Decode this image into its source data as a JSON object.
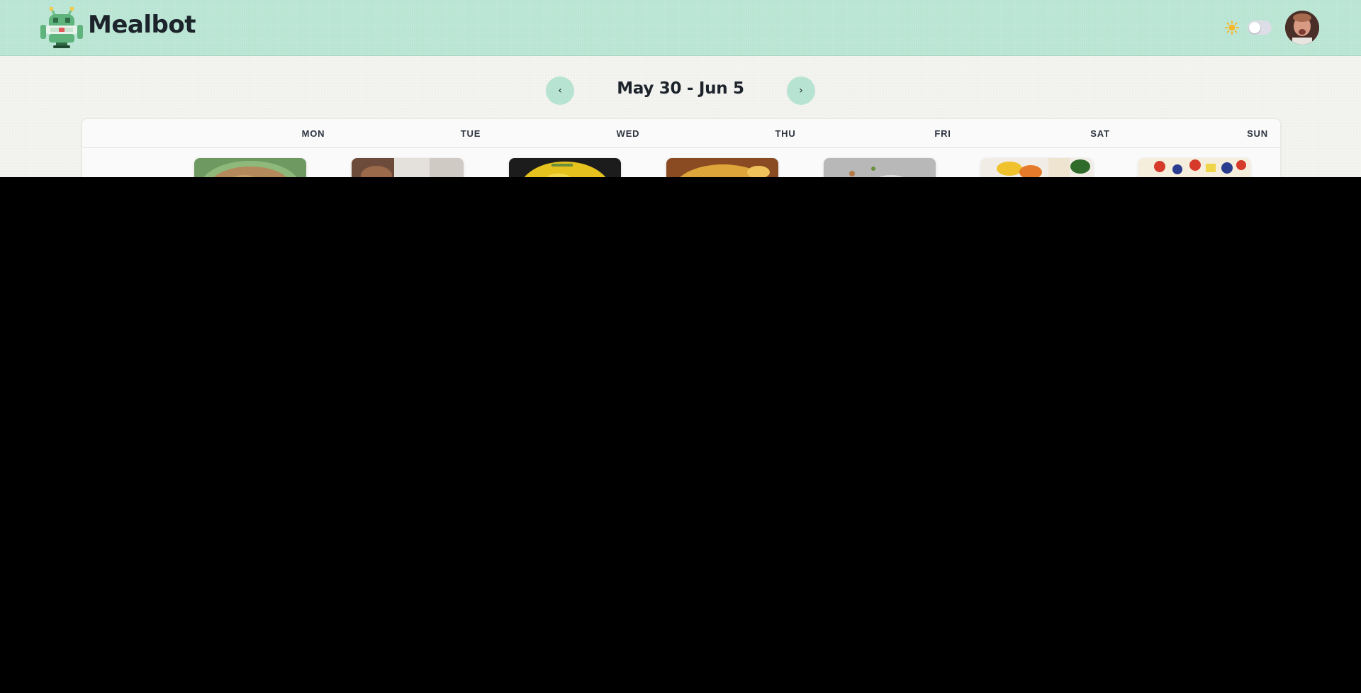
{
  "header": {
    "brand": "Mealbot",
    "logo_icon": "robot-logo-icon",
    "theme_icon": "sun-icon",
    "theme_toggle_on": false,
    "colors": {
      "header_bg": "#b7e4d2",
      "text": "#1c232b"
    }
  },
  "week": {
    "title": "May 30 - Jun 5",
    "prev_icon": "chevron-left-icon",
    "next_icon": "chevron-right-icon",
    "prev_glyph": "‹",
    "next_glyph": "›"
  },
  "calendar": {
    "days": [
      {
        "label": "MON",
        "image": "meal-photo"
      },
      {
        "label": "TUE",
        "image": "meal-photo"
      },
      {
        "label": "WED",
        "image": "meal-photo"
      },
      {
        "label": "THU",
        "image": "meal-photo"
      },
      {
        "label": "FRI",
        "image": "meal-photo"
      },
      {
        "label": "SAT",
        "image": "meal-photo"
      },
      {
        "label": "SUN",
        "image": "meal-photo"
      }
    ]
  }
}
